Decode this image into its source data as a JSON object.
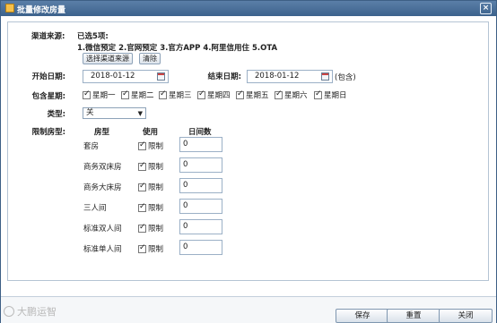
{
  "window": {
    "title": "批量修改房量",
    "close_glyph": "×"
  },
  "channel": {
    "label": "渠道来源:",
    "selected_summary": "已选5项:",
    "selected_list": "1.微信预定  2.官网预定  3.官方APP  4.阿里信用住  5.OTA",
    "select_button": "选择渠道来源",
    "clear_button": "清除"
  },
  "dates": {
    "start_label": "开始日期:",
    "start_value": "2018-01-12",
    "end_label": "结束日期:",
    "end_value": "2018-01-12",
    "inclusive_note": "(包含)"
  },
  "weekdays": {
    "label": "包含星期:",
    "items": [
      {
        "label": "星期一",
        "checked": true
      },
      {
        "label": "星期二",
        "checked": true
      },
      {
        "label": "星期三",
        "checked": true
      },
      {
        "label": "星期四",
        "checked": true
      },
      {
        "label": "星期五",
        "checked": true
      },
      {
        "label": "星期六",
        "checked": true
      },
      {
        "label": "星期日",
        "checked": true
      }
    ]
  },
  "type": {
    "label": "类型:",
    "value": "关",
    "arrow": "▼"
  },
  "rooms": {
    "label": "限制房型:",
    "headers": {
      "room": "房型",
      "use": "使用",
      "count": "日间数"
    },
    "rows": [
      {
        "name": "套房",
        "limit_label": "限制",
        "checked": true,
        "count": "0"
      },
      {
        "name": "商务双床房",
        "limit_label": "限制",
        "checked": true,
        "count": "0"
      },
      {
        "name": "商务大床房",
        "limit_label": "限制",
        "checked": true,
        "count": "0"
      },
      {
        "name": "三人间",
        "limit_label": "限制",
        "checked": true,
        "count": "0"
      },
      {
        "name": "标准双人间",
        "limit_label": "限制",
        "checked": true,
        "count": "0"
      },
      {
        "name": "标准单人间",
        "limit_label": "限制",
        "checked": true,
        "count": "0"
      }
    ]
  },
  "footer": {
    "save": "保存",
    "reset": "重置",
    "close": "关闭"
  },
  "watermark": "大鹏运智"
}
